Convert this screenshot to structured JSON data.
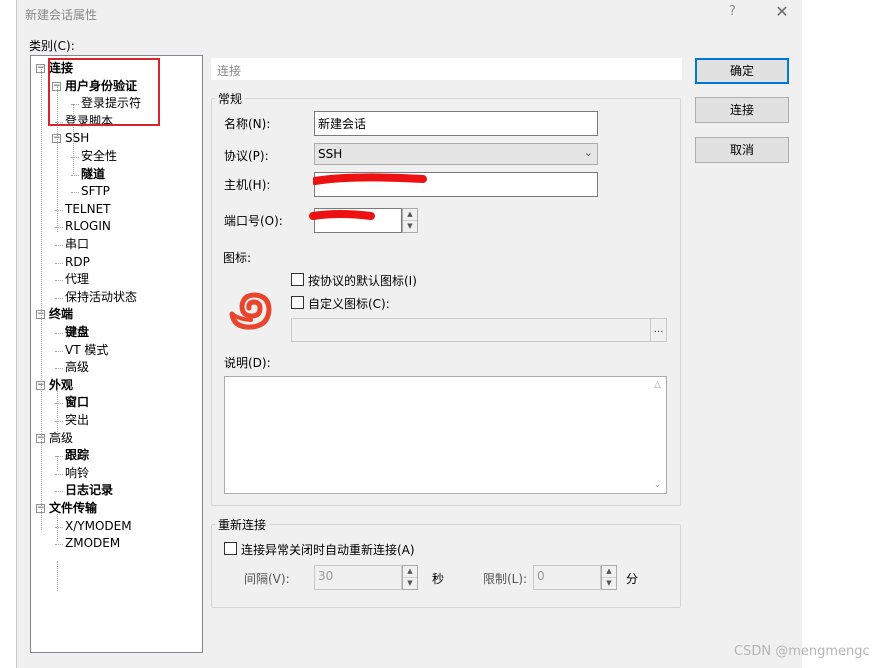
{
  "window": {
    "title": "新建会话属性",
    "help": "?",
    "close": "✕"
  },
  "category": {
    "label": "类别(C):",
    "items": [
      {
        "label": "连接",
        "bold": true,
        "expander": "−"
      },
      {
        "label": "用户身份验证",
        "bold": true,
        "expander": "−"
      },
      {
        "label": "登录提示符",
        "bold": false
      },
      {
        "label": "登录脚本",
        "bold": false
      },
      {
        "label": "SSH",
        "bold": false,
        "expander": "−"
      },
      {
        "label": "安全性",
        "bold": false
      },
      {
        "label": "隧道",
        "bold": true
      },
      {
        "label": "SFTP",
        "bold": false
      },
      {
        "label": "TELNET",
        "bold": false
      },
      {
        "label": "RLOGIN",
        "bold": false
      },
      {
        "label": "串口",
        "bold": false
      },
      {
        "label": "RDP",
        "bold": false
      },
      {
        "label": "代理",
        "bold": false
      },
      {
        "label": "保持活动状态",
        "bold": false
      },
      {
        "label": "终端",
        "bold": true,
        "expander": "−"
      },
      {
        "label": "键盘",
        "bold": true
      },
      {
        "label": "VT 模式",
        "bold": false
      },
      {
        "label": "高级",
        "bold": false
      },
      {
        "label": "外观",
        "bold": true,
        "expander": "−"
      },
      {
        "label": "窗口",
        "bold": true
      },
      {
        "label": "突出",
        "bold": false
      },
      {
        "label": "高级",
        "bold": false,
        "expander": "−"
      },
      {
        "label": "跟踪",
        "bold": true
      },
      {
        "label": "响铃",
        "bold": false
      },
      {
        "label": "日志记录",
        "bold": true
      },
      {
        "label": "文件传输",
        "bold": true,
        "expander": "−"
      },
      {
        "label": "X/YMODEM",
        "bold": false
      },
      {
        "label": "ZMODEM",
        "bold": false
      }
    ]
  },
  "section_header": "连接",
  "general": {
    "title": "常规",
    "name_label": "名称(N):",
    "name_value": "新建会话",
    "protocol_label": "协议(P):",
    "protocol_value": "SSH",
    "host_label": "主机(H):",
    "host_value": "",
    "port_label": "端口号(O):",
    "port_value": "",
    "icon_label": "图标:",
    "default_icon_label": "按协议的默认图标(I)",
    "custom_icon_label": "自定义图标(C):",
    "custom_icon_path": "",
    "browse_label": "...",
    "desc_label": "说明(D):"
  },
  "reconnect": {
    "title": "重新连接",
    "auto_label": "连接异常关闭时自动重新连接(A)",
    "interval_label": "间隔(V):",
    "interval_value": "30",
    "interval_unit": "秒",
    "limit_label": "限制(L):",
    "limit_value": "0",
    "limit_unit": "分"
  },
  "buttons": {
    "ok": "确定",
    "connect": "连接",
    "cancel": "取消"
  },
  "watermark": "CSDN @mengmengc",
  "colors": {
    "annotation_red": "#d4262c",
    "redaction_red": "#ee1111",
    "icon_orange": "#e8452c"
  }
}
